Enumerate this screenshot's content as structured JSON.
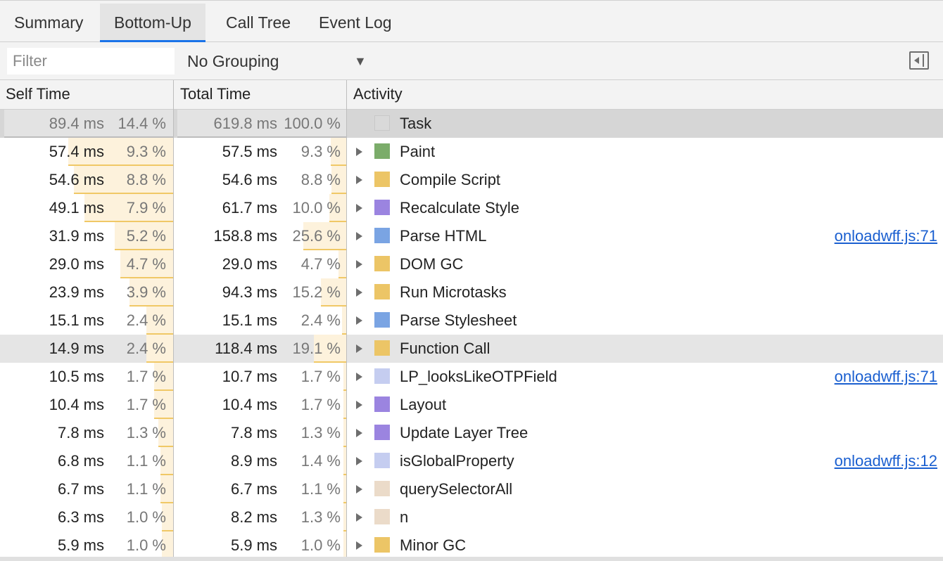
{
  "tabs": [
    "Summary",
    "Bottom-Up",
    "Call Tree",
    "Event Log"
  ],
  "filter": {
    "placeholder": "Filter",
    "value": ""
  },
  "grouping": {
    "label": "No Grouping",
    "arrow": "▼"
  },
  "columns": {
    "self": "Self Time",
    "total": "Total Time",
    "activity": "Activity"
  },
  "rows": [
    {
      "self_ms": "89.4 ms",
      "self_pct": "14.4 %",
      "self_frac": 0.144,
      "total_ms": "619.8 ms",
      "total_pct": "100.0 %",
      "total_frac": 1.0,
      "name": "Task",
      "color": "#d9d9d9",
      "link": "",
      "expandable": false
    },
    {
      "self_ms": "57.4 ms",
      "self_pct": "9.3 %",
      "self_frac": 0.093,
      "total_ms": "57.5 ms",
      "total_pct": "9.3 %",
      "total_frac": 0.093,
      "name": "Paint",
      "color": "#7bac6a",
      "link": "",
      "expandable": true
    },
    {
      "self_ms": "54.6 ms",
      "self_pct": "8.8 %",
      "self_frac": 0.088,
      "total_ms": "54.6 ms",
      "total_pct": "8.8 %",
      "total_frac": 0.088,
      "name": "Compile Script",
      "color": "#ecc566",
      "link": "",
      "expandable": true
    },
    {
      "self_ms": "49.1 ms",
      "self_pct": "7.9 %",
      "self_frac": 0.079,
      "total_ms": "61.7 ms",
      "total_pct": "10.0 %",
      "total_frac": 0.1,
      "name": "Recalculate Style",
      "color": "#9b84e0",
      "link": "",
      "expandable": true
    },
    {
      "self_ms": "31.9 ms",
      "self_pct": "5.2 %",
      "self_frac": 0.052,
      "total_ms": "158.8 ms",
      "total_pct": "25.6 %",
      "total_frac": 0.256,
      "name": "Parse HTML",
      "color": "#7aa4e3",
      "link": "onloadwff.js:71",
      "expandable": true
    },
    {
      "self_ms": "29.0 ms",
      "self_pct": "4.7 %",
      "self_frac": 0.047,
      "total_ms": "29.0 ms",
      "total_pct": "4.7 %",
      "total_frac": 0.047,
      "name": "DOM GC",
      "color": "#ecc566",
      "link": "",
      "expandable": true
    },
    {
      "self_ms": "23.9 ms",
      "self_pct": "3.9 %",
      "self_frac": 0.039,
      "total_ms": "94.3 ms",
      "total_pct": "15.2 %",
      "total_frac": 0.152,
      "name": "Run Microtasks",
      "color": "#ecc566",
      "link": "",
      "expandable": true
    },
    {
      "self_ms": "15.1 ms",
      "self_pct": "2.4 %",
      "self_frac": 0.024,
      "total_ms": "15.1 ms",
      "total_pct": "2.4 %",
      "total_frac": 0.024,
      "name": "Parse Stylesheet",
      "color": "#7aa4e3",
      "link": "",
      "expandable": true
    },
    {
      "self_ms": "14.9 ms",
      "self_pct": "2.4 %",
      "self_frac": 0.024,
      "total_ms": "118.4 ms",
      "total_pct": "19.1 %",
      "total_frac": 0.191,
      "name": "Function Call",
      "color": "#ecc566",
      "link": "",
      "expandable": true
    },
    {
      "self_ms": "10.5 ms",
      "self_pct": "1.7 %",
      "self_frac": 0.017,
      "total_ms": "10.7 ms",
      "total_pct": "1.7 %",
      "total_frac": 0.017,
      "name": "LP_looksLikeOTPField",
      "color": "#c5cdf0",
      "link": "onloadwff.js:71",
      "expandable": true
    },
    {
      "self_ms": "10.4 ms",
      "self_pct": "1.7 %",
      "self_frac": 0.017,
      "total_ms": "10.4 ms",
      "total_pct": "1.7 %",
      "total_frac": 0.017,
      "name": "Layout",
      "color": "#9b84e0",
      "link": "",
      "expandable": true
    },
    {
      "self_ms": "7.8 ms",
      "self_pct": "1.3 %",
      "self_frac": 0.013,
      "total_ms": "7.8 ms",
      "total_pct": "1.3 %",
      "total_frac": 0.013,
      "name": "Update Layer Tree",
      "color": "#9b84e0",
      "link": "",
      "expandable": true
    },
    {
      "self_ms": "6.8 ms",
      "self_pct": "1.1 %",
      "self_frac": 0.011,
      "total_ms": "8.9 ms",
      "total_pct": "1.4 %",
      "total_frac": 0.014,
      "name": "isGlobalProperty",
      "color": "#c5cdf0",
      "link": "onloadwff.js:12",
      "expandable": true
    },
    {
      "self_ms": "6.7 ms",
      "self_pct": "1.1 %",
      "self_frac": 0.011,
      "total_ms": "6.7 ms",
      "total_pct": "1.1 %",
      "total_frac": 0.011,
      "name": "querySelectorAll",
      "color": "#ebdbc9",
      "link": "",
      "expandable": true
    },
    {
      "self_ms": "6.3 ms",
      "self_pct": "1.0 %",
      "self_frac": 0.01,
      "total_ms": "8.2 ms",
      "total_pct": "1.3 %",
      "total_frac": 0.013,
      "name": "n",
      "color": "#ebdbc9",
      "link": "",
      "expandable": true
    },
    {
      "self_ms": "5.9 ms",
      "self_pct": "1.0 %",
      "self_frac": 0.01,
      "total_ms": "5.9 ms",
      "total_pct": "1.0 %",
      "total_frac": 0.01,
      "name": "Minor GC",
      "color": "#ecc566",
      "link": "",
      "expandable": true
    }
  ],
  "selected_row": 0,
  "hovered_row": 8
}
